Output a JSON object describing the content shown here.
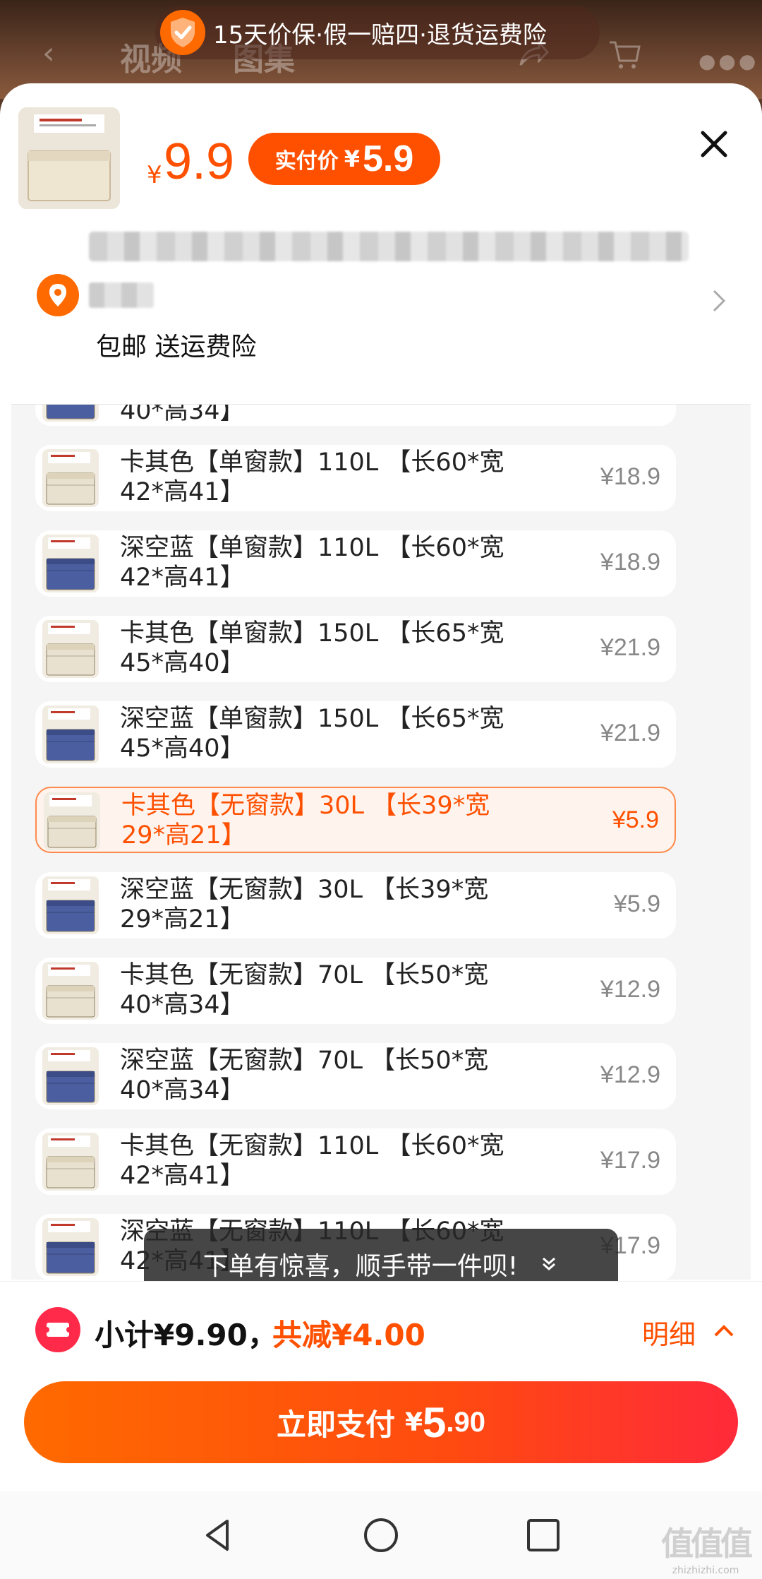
{
  "background_page": {
    "tabs": [
      "视频",
      "图集"
    ]
  },
  "guarantee": {
    "text": "15天价保·假一赔四·退货运费险",
    "accent_color": "#ff6a00"
  },
  "product": {
    "currency": "¥",
    "price": "9.9",
    "paid_label": "实付价",
    "paid_currency": "¥",
    "paid_price": "5.9"
  },
  "address": {
    "shipping": "包邮 送运费险"
  },
  "sku_list": [
    {
      "name": "40*高34】",
      "price": "",
      "swatch": "blue",
      "partial": true
    },
    {
      "name": "卡其色【单窗款】110L 【长60*宽42*高41】",
      "price": "¥18.9",
      "swatch": "khaki"
    },
    {
      "name": "深空蓝【单窗款】110L 【长60*宽42*高41】",
      "price": "¥18.9",
      "swatch": "blue"
    },
    {
      "name": "卡其色【单窗款】150L 【长65*宽45*高40】",
      "price": "¥21.9",
      "swatch": "khaki"
    },
    {
      "name": "深空蓝【单窗款】150L 【长65*宽45*高40】",
      "price": "¥21.9",
      "swatch": "blue"
    },
    {
      "name": "卡其色【无窗款】30L 【长39*宽29*高21】",
      "price": "¥5.9",
      "swatch": "khaki",
      "selected": true
    },
    {
      "name": "深空蓝【无窗款】30L 【长39*宽29*高21】",
      "price": "¥5.9",
      "swatch": "blue"
    },
    {
      "name": "卡其色【无窗款】70L 【长50*宽40*高34】",
      "price": "¥12.9",
      "swatch": "khaki"
    },
    {
      "name": "深空蓝【无窗款】70L 【长50*宽40*高34】",
      "price": "¥12.9",
      "swatch": "blue"
    },
    {
      "name": "卡其色【无窗款】110L 【长60*宽42*高41】",
      "price": "¥17.9",
      "swatch": "khaki"
    },
    {
      "name": "深空蓝【无窗款】110L 【长60*宽42*高41】",
      "price": "¥17.9",
      "swatch": "blue"
    }
  ],
  "toast": {
    "text": "下单有惊喜，顺手带一件呗!"
  },
  "summary": {
    "subtotal": "小计¥9.90，",
    "discount": "共减¥4.00",
    "detail": "明细"
  },
  "pay_button": {
    "label": "立即支付",
    "currency": "¥",
    "amount_int": "5",
    "amount_dec": ".90"
  },
  "watermark": {
    "logo": "值值值",
    "url": "zhizhizhi.com"
  },
  "colors": {
    "primary": "#ff5000",
    "selected_border": "#ff8a4c",
    "selected_bg": "#fff3ed",
    "khaki": "#e9e1cf",
    "blue": "#4b5ea0"
  }
}
